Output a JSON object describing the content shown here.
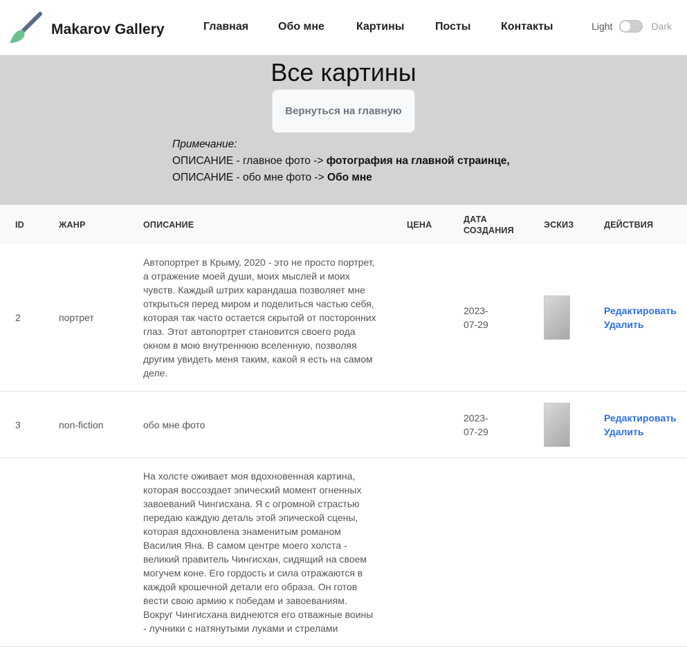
{
  "nav": {
    "brand": "Makarov Gallery",
    "links": [
      "Главная",
      "Обо мне",
      "Картины",
      "Посты",
      "Контакты"
    ],
    "theme_light": "Light",
    "theme_dark": "Dark"
  },
  "hero": {
    "title": "Все картины",
    "back_button": "Вернуться на главную",
    "note_label": "Примечание:",
    "note_line1_prefix": "ОПИСАНИЕ - главное фото -> ",
    "note_line1_bold": "фотография на главной страинце,",
    "note_line2_prefix": "ОПИСАНИЕ - обо мне фото -> ",
    "note_line2_bold": "Обо мне"
  },
  "table": {
    "headers": {
      "id": "ID",
      "genre": "ЖАНР",
      "description": "ОПИСАНИЕ",
      "price": "ЦЕНА",
      "date_line1": "ДАТА",
      "date_line2": "СОЗДАНИЯ",
      "sketch": "ЭСКИЗ",
      "actions": "ДЕЙСТВИЯ"
    },
    "rows": [
      {
        "id": "2",
        "genre": "портрет",
        "description": "Автопортрет в Крыму, 2020 - это не просто портрет, а отражение моей души, моих мыслей и моих чувств. Каждый штрих карандаша позволяет мне открыться перед миром и поделиться частью себя, которая так часто остается скрытой от посторонних глаз. Этот автопортрет становится своего рода окном в мою внутреннюю вселенную, позволяя другим увидеть меня таким, какой я есть на самом деле.",
        "price": "",
        "date": "2023-07-29",
        "edit": "Редактировать",
        "delete": "Удалить"
      },
      {
        "id": "3",
        "genre": "non-fiction",
        "description": "обо мне фото",
        "price": "",
        "date": "2023-07-29",
        "edit": "Редактировать",
        "delete": "Удалить"
      },
      {
        "id": "",
        "genre": "",
        "description": "На холсте оживает моя вдохновенная картина, которая воссоздает эпический момент огненных завоеваний Чингисхана. Я с огромной страстью передаю каждую деталь этой эпической сцены, которая вдохновлена знаменитым романом Василия Яна. В самом центре моего холста - великий правитель Чингисхан, сидящий на своем могучем коне. Его гордость и сила отражаются в каждой крошечной детали его образа. Он готов вести свою армию к победам и завоеваниям. Вокруг Чингисхана виднеются его отважные воины - лучники с натянутыми луками и стрелами",
        "price": "",
        "date": "",
        "edit": "",
        "delete": ""
      }
    ]
  },
  "colors": {
    "hero_bg": "#d3d3d3",
    "link": "#2f6fdb",
    "brush_handle": "#5a6b82",
    "brush_tip": "#6fc08f"
  },
  "icons": {
    "brand": "paintbrush-icon"
  }
}
